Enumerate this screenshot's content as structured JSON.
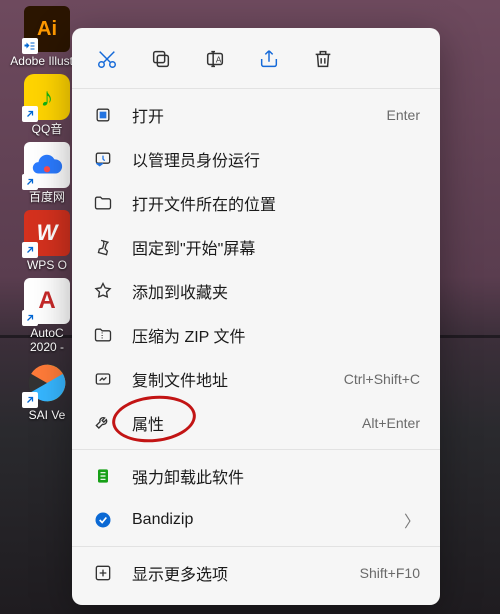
{
  "desktop": {
    "icons": [
      {
        "label": "Adobe Illustra",
        "bg": "#2b1500",
        "glyph": "Ai",
        "glyph_color": "#ff9a00"
      },
      {
        "label": "QQ音",
        "bg": "#ffd400",
        "glyph": "♪",
        "glyph_color": "#12b312"
      },
      {
        "label": "百度网",
        "bg": "#ffffff",
        "glyph": "☁",
        "glyph_color": "#2b7bff"
      },
      {
        "label": "WPS O",
        "bg": "#d4311e",
        "glyph": "W",
        "glyph_color": "#ffffff"
      },
      {
        "label": "AutoC\n2020 -",
        "bg": "#ffffff",
        "glyph": "A",
        "glyph_color": "#c62828"
      },
      {
        "label": "SAI Ve",
        "bg": "#222",
        "glyph": "●",
        "glyph_color": "#8be04e"
      }
    ]
  },
  "toolbar": {
    "cut": "cut-icon",
    "copy": "copy-icon",
    "rename": "rename-icon",
    "share": "share-icon",
    "delete": "delete-icon"
  },
  "menu": {
    "items": [
      {
        "icon": "open-icon",
        "label": "打开",
        "shortcut": "Enter"
      },
      {
        "icon": "shield-icon",
        "label": "以管理员身份运行"
      },
      {
        "icon": "folder-icon",
        "label": "打开文件所在的位置"
      },
      {
        "icon": "pin-icon",
        "label": "固定到\"开始\"屏幕"
      },
      {
        "icon": "star-icon",
        "label": "添加到收藏夹"
      },
      {
        "icon": "zip-icon",
        "label": "压缩为 ZIP 文件"
      },
      {
        "icon": "copypath-icon",
        "label": "复制文件地址",
        "shortcut": "Ctrl+Shift+C"
      },
      {
        "icon": "wrench-icon",
        "label": "属性",
        "shortcut": "Alt+Enter"
      },
      {
        "icon": "uninstall-icon",
        "label": "强力卸载此软件",
        "color": "#17a017"
      },
      {
        "icon": "bandizip-icon",
        "label": "Bandizip",
        "submenu": true,
        "color": "#0b69d4"
      },
      {
        "icon": "more-icon",
        "label": "显示更多选项",
        "shortcut": "Shift+F10"
      }
    ]
  }
}
